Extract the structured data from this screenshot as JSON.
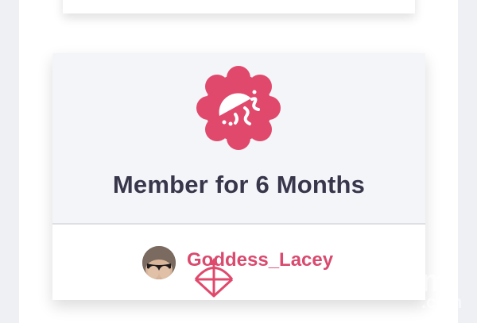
{
  "badge": {
    "title": "Member for 6 Months",
    "icon": "jellyfish-icon",
    "color": "#e0496c"
  },
  "member": {
    "username": "Goddess_Lacey",
    "avatar_icon": "avatar"
  },
  "watermark": {
    "icon": "bow-arrow-icon",
    "text": "om",
    "sub": ".com"
  },
  "colors": {
    "accent": "#d94a6e",
    "title_text": "#37364b",
    "card_upper_bg": "#f4f5f9"
  }
}
